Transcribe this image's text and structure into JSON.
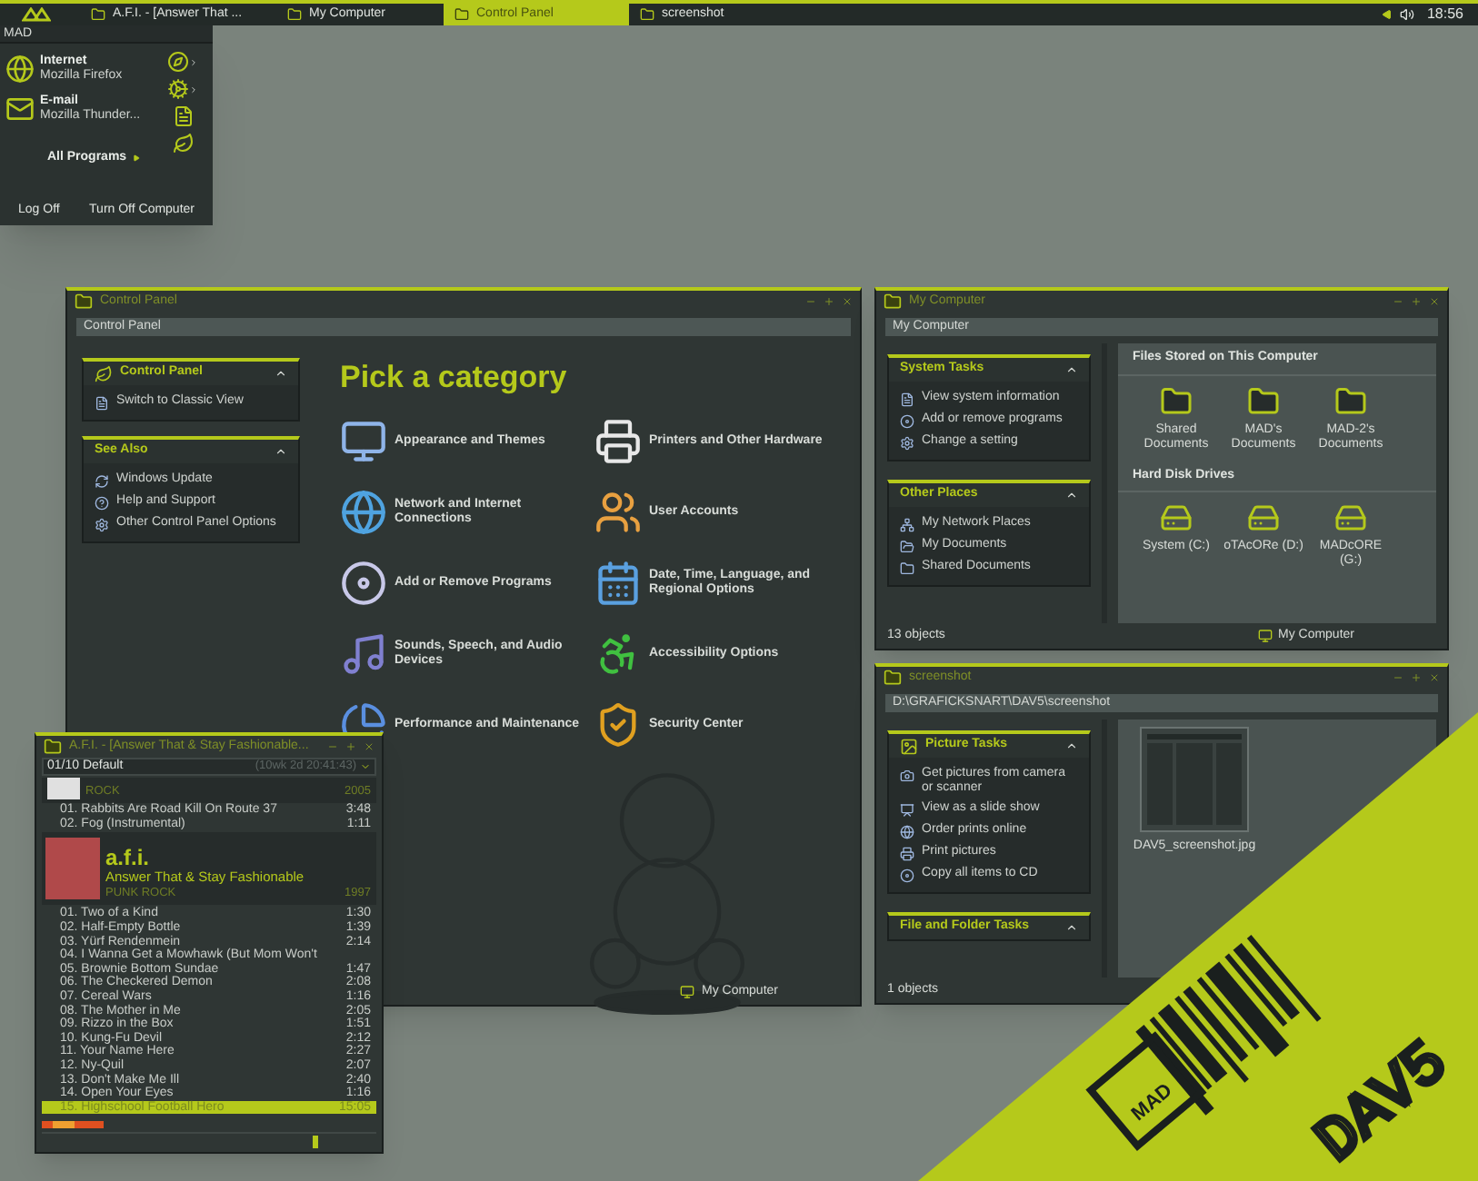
{
  "taskbar": {
    "tasks": [
      {
        "title": "A.F.I. - [Answer That ...",
        "selected": false
      },
      {
        "title": "My Computer",
        "selected": false
      },
      {
        "title": "Control Panel",
        "selected": true
      },
      {
        "title": "screenshot",
        "selected": false
      }
    ],
    "clock": "18:56"
  },
  "start_menu": {
    "user": "MAD",
    "programs": [
      {
        "name": "Internet",
        "detail": "Mozilla Firefox"
      },
      {
        "name": "E-mail",
        "detail": "Mozilla Thunder..."
      }
    ],
    "all_programs": "All Programs",
    "log_off": "Log Off",
    "turn_off": "Turn Off Computer"
  },
  "control_panel": {
    "title": "Control Panel",
    "address": "Control Panel",
    "panes": [
      {
        "title": "Control Panel",
        "expanded": true,
        "items": [
          "Switch to Classic View"
        ]
      },
      {
        "title": "See Also",
        "expanded": true,
        "items": [
          "Windows Update",
          "Help and Support",
          "Other Control Panel Options"
        ]
      }
    ],
    "heading": "Pick a category",
    "categories": [
      "Appearance and Themes",
      "Printers and Other Hardware",
      "Network and Internet Connections",
      "User Accounts",
      "Add or Remove Programs",
      "Date, Time, Language, and Regional Options",
      "Sounds, Speech, and Audio Devices",
      "Accessibility Options",
      "Performance and Maintenance",
      "Security Center"
    ],
    "status": "My Computer"
  },
  "my_computer": {
    "title": "My Computer",
    "address": "My Computer",
    "panes": [
      {
        "title": "System Tasks",
        "expanded": true,
        "items": [
          "View system information",
          "Add or remove programs",
          "Change a setting"
        ]
      },
      {
        "title": "Other Places",
        "expanded": true,
        "items": [
          "My Network Places",
          "My Documents",
          "Shared Documents"
        ]
      }
    ],
    "groups": [
      {
        "title": "Files Stored on This Computer",
        "kind": "folder",
        "items": [
          "Shared Documents",
          "MAD's Documents",
          "MAD-2's Documents"
        ]
      },
      {
        "title": "Hard Disk Drives",
        "kind": "drive",
        "items": [
          "System (C:)",
          "oTAcORe (D:)",
          "MADcORE (G:)"
        ]
      }
    ],
    "count": "13 objects",
    "location": "My Computer"
  },
  "screenshot": {
    "title": "screenshot",
    "address": "D:\\GRAFICKSNART\\DAV5\\screenshot",
    "panes": [
      {
        "title": "Picture Tasks",
        "expanded": true,
        "items": [
          "Get pictures from camera or scanner",
          "View as a slide show",
          "Order prints online",
          "Print pictures",
          "Copy all items to CD"
        ]
      },
      {
        "title": "File and Folder Tasks",
        "expanded": true
      }
    ],
    "files": [
      "DAV5_screenshot.jpg"
    ],
    "count": "1 objects"
  },
  "player": {
    "title": "A.F.I. - [Answer That & Stay Fashionable...",
    "playlist": "01/10 Default",
    "total_time": "(10wk 2d 20:41:43)",
    "albums": [
      {
        "genre": "ROCK",
        "year": "2005",
        "tracks": [
          {
            "title": "01. Rabbits Are Road Kill On Route 37",
            "time": "3:48",
            "selected": false
          },
          {
            "title": "02. Fog (Instrumental)",
            "time": "1:11",
            "selected": false
          }
        ]
      },
      {
        "artist": "a.f.i.",
        "album": "Answer That & Stay Fashionable",
        "genre": "PUNK ROCK",
        "year": "1997",
        "tracks": [
          {
            "title": "01. Two of a Kind",
            "time": "1:30",
            "selected": false
          },
          {
            "title": "02. Half-Empty Bottle",
            "time": "1:39",
            "selected": false
          },
          {
            "title": "03. Yürf Rendenmein",
            "time": "2:14",
            "selected": false
          },
          {
            "title": "04. I Wanna Get a Mowhawk (But Mom Won't",
            "selected": false
          },
          {
            "title": "05. Brownie Bottom Sundae",
            "time": "1:47",
            "selected": false
          },
          {
            "title": "06. The Checkered Demon",
            "time": "2:08",
            "selected": false
          },
          {
            "title": "07. Cereal Wars",
            "time": "1:16",
            "selected": false
          },
          {
            "title": "08. The Mother in Me",
            "time": "2:05",
            "selected": false
          },
          {
            "title": "09. Rizzo in the Box",
            "time": "1:51",
            "selected": false
          },
          {
            "title": "10. Kung-Fu Devil",
            "time": "2:12",
            "selected": false
          },
          {
            "title": "11. Your Name Here",
            "time": "2:27",
            "selected": false
          },
          {
            "title": "12. Ny-Quil",
            "time": "2:07",
            "selected": false
          },
          {
            "title": "13. Don't Make Me Ill",
            "time": "2:40",
            "selected": false
          },
          {
            "title": "14. Open Your Eyes",
            "time": "1:16",
            "selected": false
          },
          {
            "title": "15. Highschool Football Hero",
            "time": "15:05",
            "selected": true
          }
        ]
      }
    ],
    "volume": {
      "level": 0.82
    }
  },
  "banner": {
    "brand": "DAV5",
    "badge": "MAD"
  }
}
